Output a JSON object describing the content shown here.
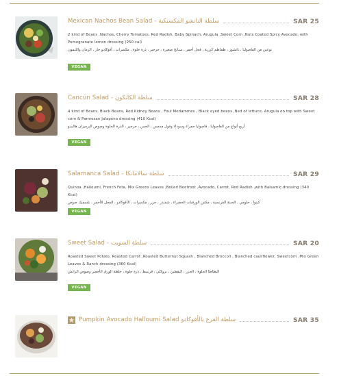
{
  "currency_label": "SAR",
  "badge_label": "VEGAN",
  "items": [
    {
      "title": "Mexican Nachos Bean Salad - سلطة الناتشو المكسيكية",
      "price": "SAR 25",
      "desc_en": "2 kind of Beans ,Nachos, Cherry Tomatoes, Red Radish, Baby Spinach, Arugula ,Sweet Corn ,Nuts Coated Spicy Avocado, with Pomegranate lemon dressing (250 cal)",
      "desc_ar": "نوعين من الفاصوليا ، ناتشوز ، طماطم كرزية ، فجل أحمر ، سبانخ صغيرة ، جرجير ، ذرة حلوة ، مكسرات ، أفوكادو حار ، الرمان والليمون",
      "vegan": true,
      "image": "bowl-salad-1"
    },
    {
      "title": "Cancún Salad - سلطة الكانكون",
      "price": "SAR 28",
      "desc_en": "4 kind of Beans, Black Beans, Red Kidney Beans , Foul Medammes , Black eyed beans ,Bed of lettuce, Arugula on top with Sweet corn & Parmesan Jalapeno dressing (410 Kcal)",
      "desc_ar": "أربع أنواع من الفاصوليا ، فاصوليا حمراء وسوداء وفول مدمس ، الخس ، جرجير ، الذرة الحلوة وصوص البرميزان هالبينو",
      "vegan": true,
      "image": "bowl-salad-2"
    },
    {
      "title": "Salamanca Salad - سلطة سالامانكا",
      "price": "SAR 29",
      "desc_en": "Quinoa ,Halloumi, French Feta, Mix Greens Leaves ,Boiled Beetroot ,Avocado, Carrot, Red Radish ,with Balsamic dressing (340 Kcal)",
      "desc_ar": "كينوا ، حلومي ، الجبنة الفرنسية ، مكس الورقيات الخضراء ، شمندر ، جزر ، مكسرات ، الأفوكادو ، الفجل الأحمر ، بلسميك صوص",
      "vegan": true,
      "image": "bowl-salad-3"
    },
    {
      "title": "Sweet Salad - سلطة السويت",
      "price": "SAR 20",
      "desc_en": "Roasted Sweet Potato, Roasted Carrot ,Roasted Butternut Squash , Blanched Broccoli , Blanched cauliflower, Sweetcorn ,Mix Green Leaves & Ranch dressing (360 Kcal)",
      "desc_ar": "البطاطا الحلوة ، الجزر ، اليقطين ، بروكلي ، قرنبيط ، ذرة حلوة ، خلطة الورق الأخضر وصوص الرانش",
      "vegan": true,
      "image": "bowl-salad-4"
    },
    {
      "title": "Pumpkin Avocado Halloumi Salad سلطة القرع بالأفوكادو",
      "price": "SAR 35",
      "desc_en": "",
      "desc_ar": "",
      "vegan": false,
      "featured": true,
      "image": "bowl-salad-5"
    }
  ]
}
